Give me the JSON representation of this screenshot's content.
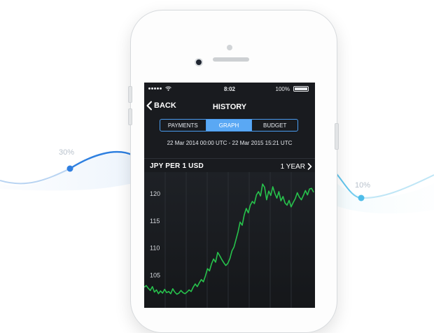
{
  "background": {
    "left_percent": "30%",
    "right_percent": "10%",
    "colors": {
      "left_curve": "#2f80e0",
      "right_curve": "#62c6ee"
    }
  },
  "status_bar": {
    "time": "8:02",
    "battery": "100%",
    "icons": [
      "signal-dots-icon",
      "wifi-icon",
      "battery-icon"
    ]
  },
  "nav": {
    "back_label": "BACK",
    "title": "HISTORY",
    "back_icon": "chevron-left-icon"
  },
  "tabs": {
    "items": [
      {
        "label": "PAYMENTS",
        "active": false
      },
      {
        "label": "GRAPH",
        "active": true
      },
      {
        "label": "BUDGET",
        "active": false
      }
    ],
    "accent_color": "#5aa8f4"
  },
  "date_range": "22 Mar 2014 00:00 UTC - 22 Mar 2015 15:21 UTC",
  "chart_header": {
    "pair_label": "JPY PER 1 USD",
    "period_label": "1 YEAR",
    "period_icon": "chevron-right-icon"
  },
  "chart_data": {
    "type": "line",
    "title": "JPY PER 1 USD",
    "xlabel": "",
    "ylabel": "",
    "y_ticks": [
      "120",
      "115",
      "110",
      "105"
    ],
    "ylim": [
      99,
      124
    ],
    "grid": true,
    "line_color": "#27c24c",
    "series": [
      {
        "values": [
          102.8,
          103.1,
          102.6,
          102.2,
          102.9,
          101.9,
          102.3,
          101.6,
          102.1,
          101.7,
          102.4,
          101.8,
          102.0,
          101.6,
          102.5,
          101.9,
          101.5,
          101.7,
          102.2,
          101.8,
          101.6,
          101.9,
          102.3,
          102.0,
          102.8,
          103.4,
          102.9,
          103.6,
          104.2,
          103.8,
          104.9,
          106.2,
          105.8,
          107.1,
          108.0,
          107.4,
          109.2,
          108.6,
          107.9,
          107.3,
          106.8,
          107.2,
          108.1,
          109.5,
          110.2,
          111.6,
          113.0,
          114.8,
          114.2,
          116.1,
          117.3,
          116.5,
          117.9,
          118.6,
          118.2,
          119.8,
          120.4,
          119.6,
          121.8,
          121.2,
          118.9,
          120.5,
          119.7,
          121.3,
          120.1,
          119.2,
          120.4,
          118.7,
          119.5,
          118.3,
          117.9,
          118.8,
          117.6,
          118.4,
          119.1,
          120.2,
          119.4,
          118.9,
          119.7,
          120.6,
          119.8,
          120.9,
          121.0,
          120.3
        ]
      }
    ]
  }
}
